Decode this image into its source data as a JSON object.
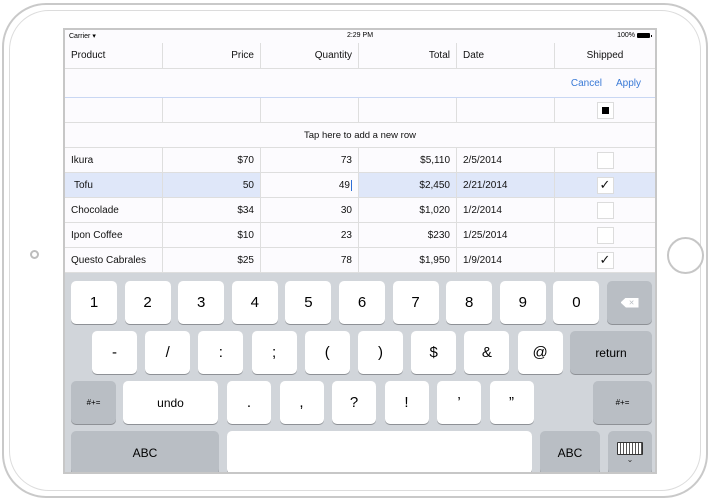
{
  "statusbar": {
    "carrier": "Carrier",
    "wifi_icon": "wifi-icon",
    "time": "2:29 PM",
    "battery": "100%"
  },
  "grid": {
    "columns": [
      "Product",
      "Price",
      "Quantity",
      "Total",
      "Date",
      "Shipped"
    ],
    "actions": {
      "cancel": "Cancel",
      "apply": "Apply"
    },
    "filter_row": {
      "shipped_state": "indeterminate"
    },
    "add_row_label": "Tap here to add a new row",
    "rows": [
      {
        "product": "Ikura",
        "price": "$70",
        "quantity": "73",
        "total": "$5,110",
        "date": "2/5/2014",
        "shipped": false,
        "selected": false
      },
      {
        "product": "Tofu",
        "price": "50",
        "quantity": "49",
        "total": "$2,450",
        "date": "2/21/2014",
        "shipped": true,
        "selected": true,
        "editing": "quantity"
      },
      {
        "product": "Chocolade",
        "price": "$34",
        "quantity": "30",
        "total": "$1,020",
        "date": "1/2/2014",
        "shipped": false,
        "selected": false
      },
      {
        "product": "Ipon Coffee",
        "price": "$10",
        "quantity": "23",
        "total": "$230",
        "date": "1/25/2014",
        "shipped": false,
        "selected": false
      },
      {
        "product": "Questo Cabrales",
        "price": "$25",
        "quantity": "78",
        "total": "$1,950",
        "date": "1/9/2014",
        "shipped": true,
        "selected": false
      }
    ],
    "check_glyph": "✓"
  },
  "keyboard": {
    "row1": [
      "1",
      "2",
      "3",
      "4",
      "5",
      "6",
      "7",
      "8",
      "9",
      "0"
    ],
    "backspace_icon": "backspace-icon",
    "row2": [
      "-",
      "/",
      ":",
      ";",
      "(",
      ")",
      "$",
      "&",
      "@"
    ],
    "return": "return",
    "symbols_left": "#+=",
    "undo": "undo",
    "row3": [
      ".",
      ",",
      "?",
      "!",
      "’",
      "”"
    ],
    "symbols_right": "#+=",
    "abc_left": "ABC",
    "space": "",
    "abc_right": "ABC",
    "dismiss_icon": "keyboard-dismiss-icon"
  }
}
